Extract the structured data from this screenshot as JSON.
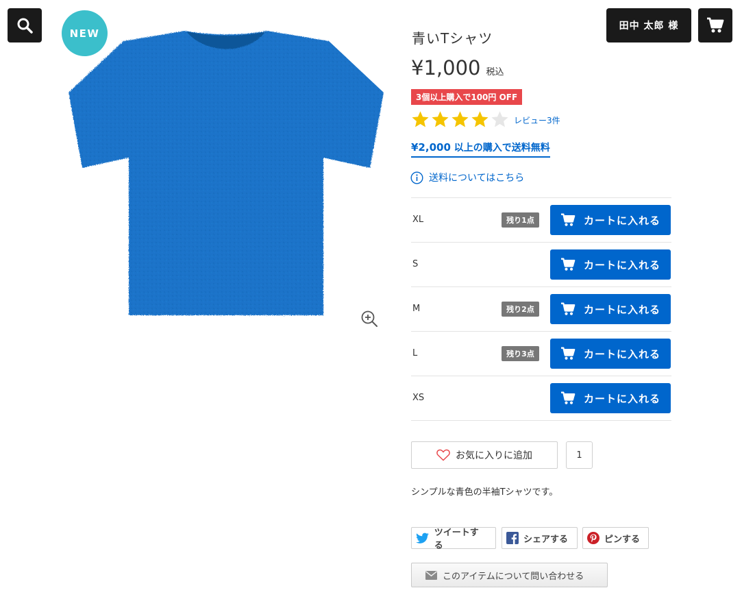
{
  "header": {
    "user_label": "田中 太郎 様"
  },
  "product": {
    "new_badge": "NEW",
    "title": "青いTシャツ",
    "price": "¥1,000",
    "tax_label": "税込",
    "discount": "3個以上購入で100円 OFF",
    "rating": 4,
    "rating_max": 5,
    "review_link": "レビュー3件",
    "shipping_amount": "¥2,000",
    "shipping_text": " 以上の購入で送料無料",
    "shipping_info": "送料についてはこちら",
    "description": "シンプルな青色の半袖Tシャツです。"
  },
  "variants": [
    {
      "size": "XL",
      "stock": "残り1点",
      "button": "カートに入れる"
    },
    {
      "size": "S",
      "stock": "",
      "button": "カートに入れる"
    },
    {
      "size": "M",
      "stock": "残り2点",
      "button": "カートに入れる"
    },
    {
      "size": "L",
      "stock": "残り3点",
      "button": "カートに入れる"
    },
    {
      "size": "XS",
      "stock": "",
      "button": "カートに入れる"
    }
  ],
  "favorite": {
    "label": "お気に入りに追加",
    "count": "1"
  },
  "share": {
    "tweet": "ツイートする",
    "facebook": "シェアする",
    "pinterest": "ピンする"
  },
  "inquiry": {
    "label": "このアイテムについて問い合わせる"
  },
  "colors": {
    "accent": "#0066cc",
    "discount": "#e8474b",
    "new_badge": "#3bbfcb",
    "shirt": "#1a73c9",
    "header_button": "#1a1a1a",
    "star": "#f5c400"
  }
}
